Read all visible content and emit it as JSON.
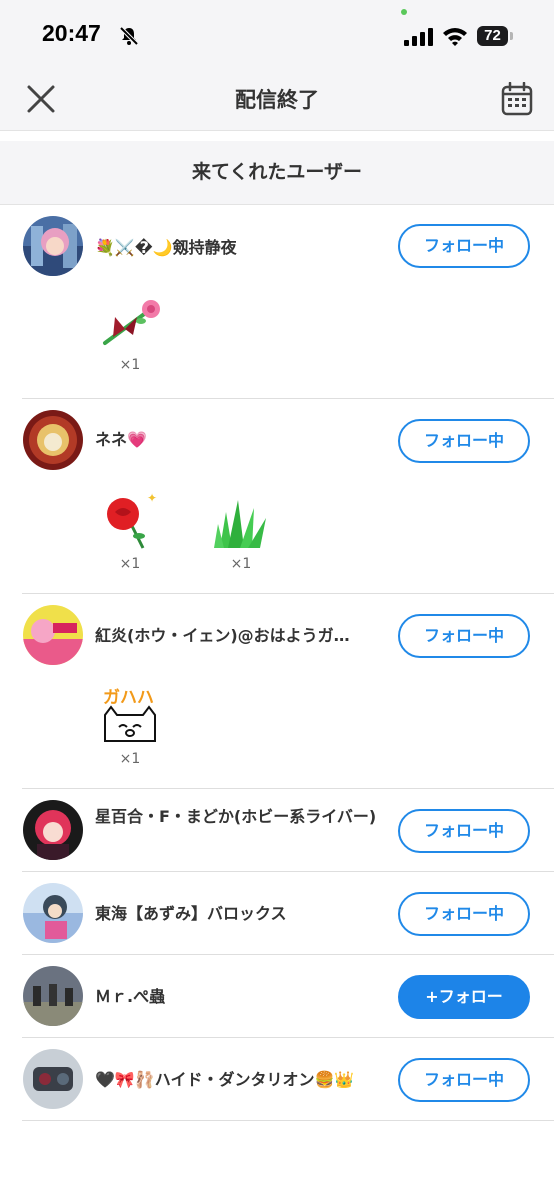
{
  "status_bar": {
    "time": "20:47",
    "battery": "72"
  },
  "nav": {
    "title": "配信終了"
  },
  "section": {
    "title": "来てくれたユーザー"
  },
  "users": [
    {
      "name": "💐⚔️�🌙剱持静夜",
      "button": "フォロー中",
      "gifts": [
        {
          "icon": "rose-bouquet-icon",
          "count": "×1"
        }
      ]
    },
    {
      "name": "ネネ💗",
      "button": "フォロー中",
      "gifts": [
        {
          "icon": "red-rose-icon",
          "count": "×1"
        },
        {
          "icon": "grass-icon",
          "count": "×1"
        }
      ]
    },
    {
      "name": "紅炎(ホウ・イェン)@おはようガ…",
      "button": "フォロー中",
      "gifts": [
        {
          "icon": "gahaha-cat-icon",
          "count": "×1"
        }
      ]
    },
    {
      "name": "星百合・F・まどか(ホビー系ライバー)",
      "button": "フォロー中",
      "gifts": []
    },
    {
      "name": "東海【あずみ】バロックス",
      "button": "フォロー中",
      "gifts": []
    },
    {
      "name": "Ｍｒ.ぺ蟲",
      "button": "+フォロー",
      "gifts": []
    },
    {
      "name": "🖤🎀🩰ハイド・ダンタリオン🍔👑",
      "button": "フォロー中",
      "gifts": []
    }
  ],
  "colors": {
    "accent": "#2089e8",
    "header_bg": "#f5f5f7",
    "divider": "#dedede"
  }
}
